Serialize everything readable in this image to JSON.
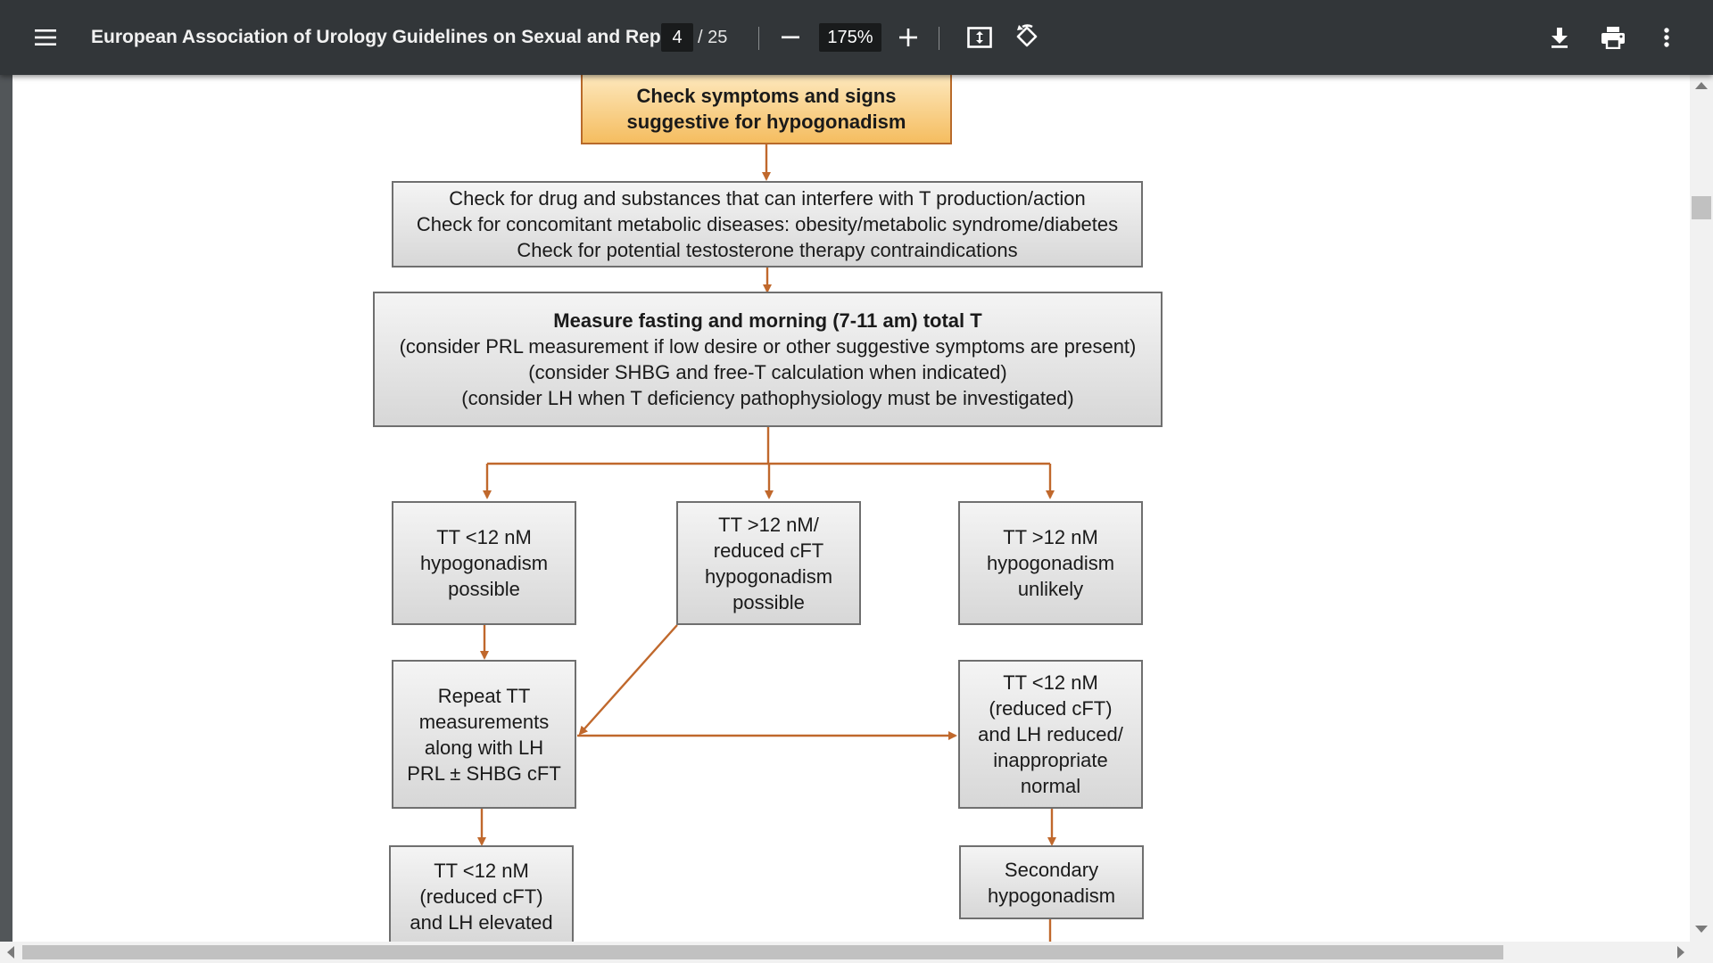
{
  "toolbar": {
    "title": "European Association of Urology Guidelines on Sexual and Repr...",
    "page_current": "4",
    "page_total": "/ 25",
    "zoom": "175%",
    "icons": [
      "menu-icon",
      "zoom-out-icon",
      "zoom-in-icon",
      "fit-page-icon",
      "rotate-icon",
      "download-icon",
      "print-icon",
      "more-vert-icon"
    ]
  },
  "flowchart": {
    "start": [
      "Check symptoms and signs",
      "suggestive for hypogonadism"
    ],
    "checks": [
      "Check for drug and substances that can interfere with T production/action",
      "Check for concomitant metabolic diseases: obesity/metabolic syndrome/diabetes",
      "Check for potential testosterone therapy contraindications"
    ],
    "measure": {
      "title": "Measure fasting and morning (7-11 am) total T",
      "lines": [
        "(consider PRL measurement if low desire or other suggestive symptoms are present)",
        "(consider SHBG and free-T calculation when indicated)",
        "(consider LH when T deficiency pathophysiology must be investigated)"
      ]
    },
    "tt_low": [
      "TT <12 nM",
      "hypogonadism",
      "possible"
    ],
    "tt_reduced_cft": [
      "TT >12 nM/",
      "reduced cFT",
      "hypogonadism",
      "possible"
    ],
    "tt_high": [
      "TT >12 nM",
      "hypogonadism",
      "unlikely"
    ],
    "repeat": [
      "Repeat TT",
      "measurements",
      "along with LH",
      "PRL ± SHBG cFT"
    ],
    "lh_reduced": [
      "TT <12 nM",
      "(reduced cFT)",
      "and LH reduced/",
      "inappropriate",
      "normal"
    ],
    "lh_elevated": [
      "TT <12 nM",
      "(reduced cFT)",
      "and LH elevated"
    ],
    "secondary": [
      "Secondary",
      "hypogonadism"
    ]
  },
  "colors": {
    "toolbar_bg": "#323639",
    "viewer_bg": "#525659",
    "arrow": "#c0682c",
    "start_box_fill": "#f5bd60"
  }
}
